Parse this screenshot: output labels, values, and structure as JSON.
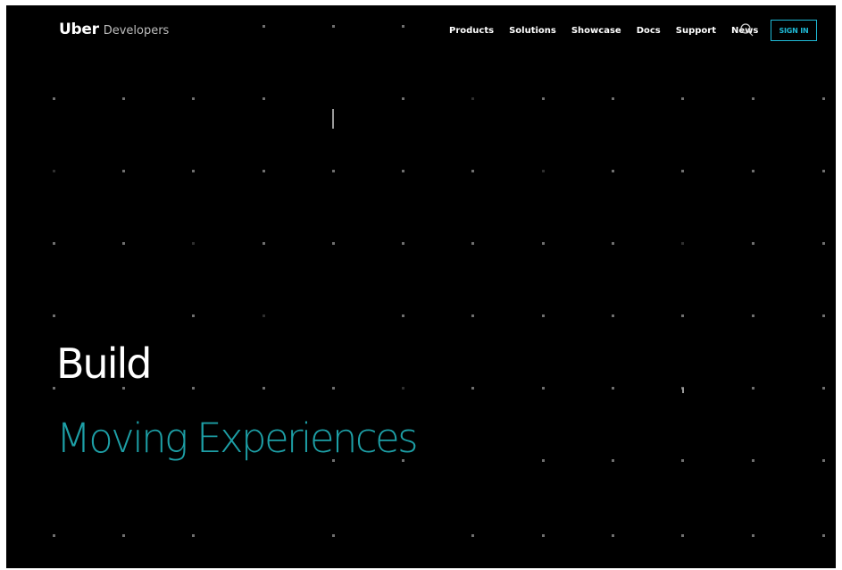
{
  "header": {
    "brand_name": "Uber",
    "brand_suffix": "Developers",
    "nav": [
      {
        "label": "Products"
      },
      {
        "label": "Solutions"
      },
      {
        "label": "Showcase"
      },
      {
        "label": "Docs"
      },
      {
        "label": "Support"
      },
      {
        "label": "News"
      }
    ],
    "search_icon": "search-icon",
    "signin_label": "SIGN IN"
  },
  "hero": {
    "line1": "Build",
    "line2": "Moving Experiences"
  },
  "colors": {
    "background": "#000000",
    "accent": "#1fbad6",
    "hero_accent": "#1d9fa6",
    "text": "#ffffff"
  }
}
